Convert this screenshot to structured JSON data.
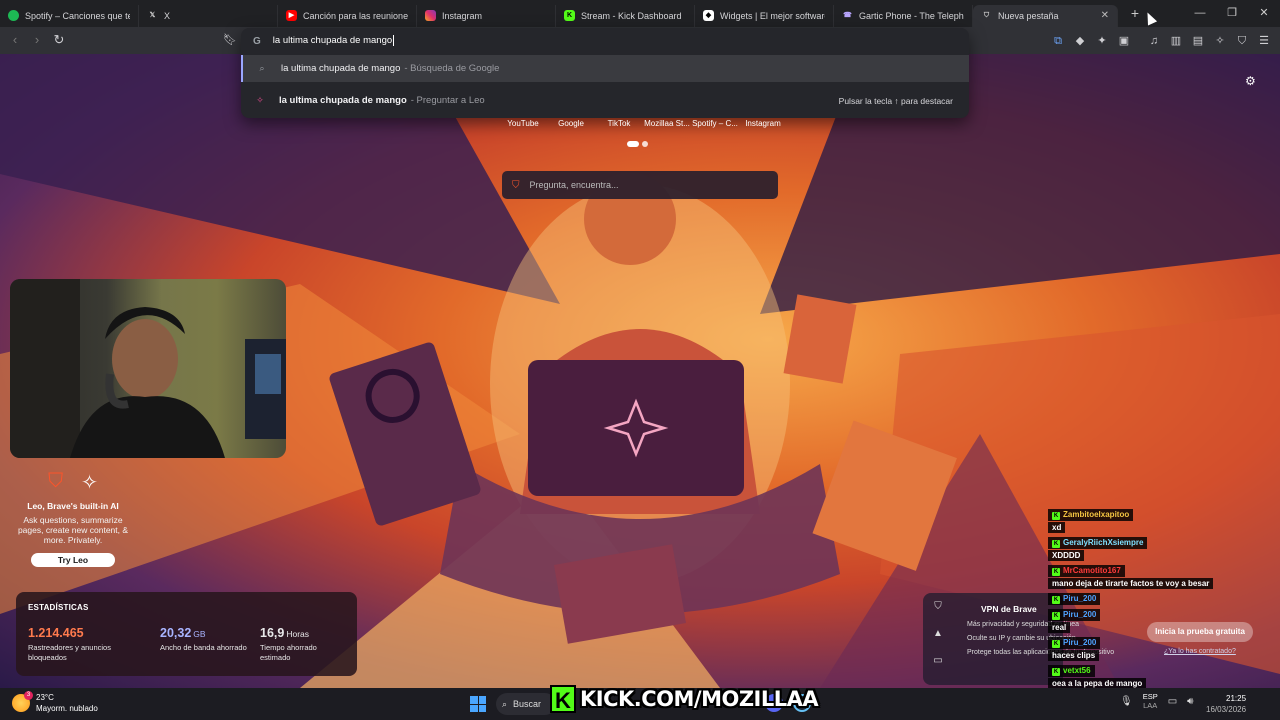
{
  "tabs": [
    {
      "title": "Spotify – Canciones que te gus",
      "favicon": "spotify-icon",
      "color": "#1db954"
    },
    {
      "title": "X",
      "favicon": "x-icon",
      "color": "#000000"
    },
    {
      "title": "Canción para las reuniones del",
      "favicon": "youtube-icon",
      "color": "#ff0000"
    },
    {
      "title": "Instagram",
      "favicon": "instagram-icon",
      "color": "#e1306c"
    },
    {
      "title": "Stream - Kick Dashboard",
      "favicon": "kick-icon",
      "color": "#53fc18"
    },
    {
      "title": "Widgets | El mejor software pa",
      "favicon": "widgets-icon",
      "color": "#ffffff"
    },
    {
      "title": "Gartic Phone - The Telephone",
      "favicon": "phone-icon",
      "color": "#7a5cff"
    },
    {
      "title": "Nueva pestaña",
      "favicon": "brave-icon",
      "color": "#fb542b",
      "active": true
    }
  ],
  "omnibox": {
    "value": "la ultima chupada de mango",
    "suggestions": [
      {
        "main": "la ultima chupada de mango",
        "secondary": "- Búsqueda de Google"
      },
      {
        "main": "la ultima chupada de mango",
        "secondary": "- Preguntar a Leo",
        "hint": "Pulsar la tecla ↑ para destacar"
      }
    ]
  },
  "top_sites": [
    "YouTube",
    "Google",
    "TikTok",
    "Mozillaa St...",
    "Spotify – C...",
    "Instagram"
  ],
  "search": {
    "placeholder": "Pregunta, encuentra..."
  },
  "leo": {
    "title": "Leo, Brave's built-in AI",
    "description": "Ask questions, summarize pages, create new content, & more. Privately.",
    "button": "Try Leo"
  },
  "stats": {
    "heading": "ESTADÍSTICAS",
    "items": [
      {
        "value": "1.214.465",
        "unit": "",
        "label": "Rastreadores y anuncios bloqueados",
        "color": "#ff7a4d"
      },
      {
        "value": "20,32",
        "unit": "GB",
        "label": "Ancho de banda ahorrado",
        "color": "#a8b4ff"
      },
      {
        "value": "16,9",
        "unit": "Horas",
        "label": "Tiempo ahorrado estimado",
        "color": "#ffffff"
      }
    ]
  },
  "vpn": {
    "title": "VPN de Brave",
    "lines": [
      "Más privacidad y seguridad en línea",
      "Oculte su IP y cambie su ubicación",
      "Protege todas las aplicaciones de tu dispositivo"
    ],
    "cta": "Inicia la prueba gratuita",
    "already": "¿Ya lo has contratado?"
  },
  "chat": [
    {
      "user": "Zambitoelxapitoo",
      "text": "xd",
      "color": "#f5c542"
    },
    {
      "user": "GeralyRiichXsiempre",
      "text": "XDDDD",
      "color": "#7ee0ff"
    },
    {
      "user": "MrCamotito167",
      "text": "mano deja de tirarte factos te voy a besar",
      "color": "#ff3b3b"
    },
    {
      "user": "Piru_200",
      "text": "",
      "color": "#4ea3ff"
    },
    {
      "user": "Piru_200",
      "text": "real",
      "color": "#4ea3ff"
    },
    {
      "user": "Piru_200",
      "text": "haces clips",
      "color": "#4ea3ff"
    },
    {
      "user": "vetxt56",
      "text": "oea a la pepa de mango",
      "color": "#53fc18"
    }
  ],
  "taskbar": {
    "weather_temp": "23°C",
    "weather_desc": "Mayorm. nublado",
    "weather_badge": "3",
    "search_label": "Buscar",
    "kick_url": "KICK.COM/MOZILLAA",
    "lang": "ESP",
    "lang_sub": "LAA",
    "time": "21:25",
    "date": "16/03/2026"
  },
  "colors": {
    "accent": "#53fc18",
    "brave": "#fb542b"
  }
}
